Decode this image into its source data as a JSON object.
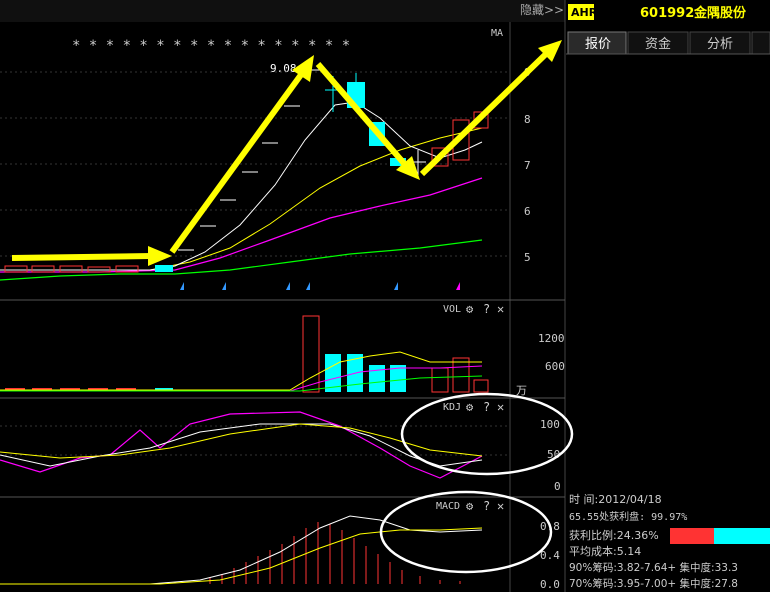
{
  "topbar": {
    "hide_label": "隐藏>>",
    "market_badge": "AHR",
    "stock_code": "601992",
    "stock_name": "金隅股份"
  },
  "tabs": [
    {
      "label": "报价",
      "active": true
    },
    {
      "label": "资金",
      "active": false
    },
    {
      "label": "分析",
      "active": false
    }
  ],
  "main_panel": {
    "ma_label": "MA",
    "high_label": "9.08",
    "stars": "* *      * * * * * * * * * *    * * * * *",
    "price_ticks": [
      "9",
      "8",
      "7",
      "6",
      "5"
    ]
  },
  "vol_panel": {
    "title": "VOL",
    "unit": "万",
    "ticks": [
      "1200",
      "600"
    ]
  },
  "kdj_panel": {
    "title": "KDJ",
    "ticks": [
      "100",
      "50",
      "0"
    ]
  },
  "macd_panel": {
    "title": "MACD",
    "ticks": [
      "0.8",
      "0.4",
      "0.0"
    ]
  },
  "panel_controls": {
    "settings_icon": "⚙",
    "help": "?",
    "close": "✕"
  },
  "info": {
    "time_label": "时      间:2012/04/18",
    "profit_line": "65.55处获利盘: 99.97%",
    "profit_ratio": "获利比例:24.36%",
    "avg_cost": "平均成本:5.14",
    "chip90": "90%筹码:3.82-7.64+ 集中度:33.3",
    "chip70": "70%筹码:3.95-7.00+ 集中度:27.8"
  },
  "colors": {
    "up": "#ff3333",
    "down": "#00ffff",
    "ma5": "#ffffff",
    "ma10": "#ffff00",
    "ma20": "#ff00ff",
    "ma60": "#00ff00",
    "arrow": "#ffff00",
    "badge_bg": "#ffff00"
  }
}
